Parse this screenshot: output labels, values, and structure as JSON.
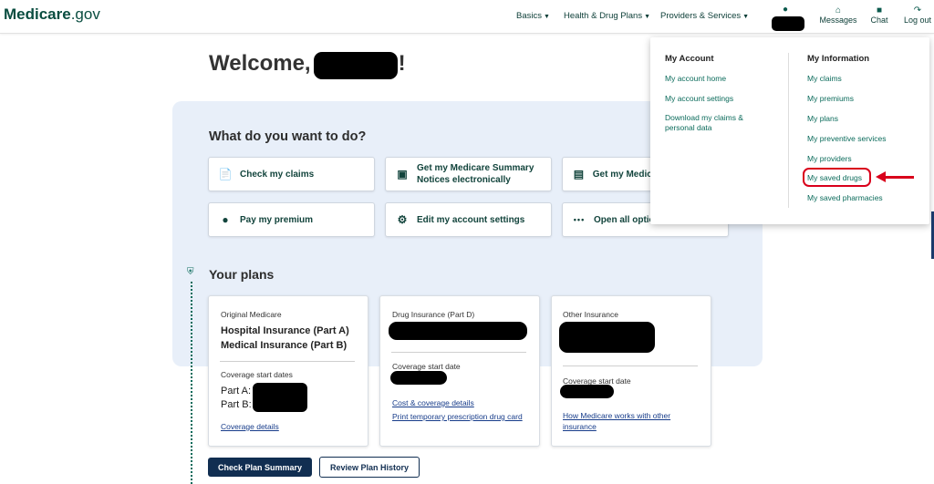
{
  "header": {
    "logo_main": "Medicare",
    "logo_suffix": ".gov",
    "nav": [
      {
        "label": "Basics"
      },
      {
        "label": "Health & Drug Plans"
      },
      {
        "label": "Providers & Services"
      }
    ],
    "icons": [
      {
        "label": "Messages",
        "icon": "home-mail-icon"
      },
      {
        "label": "Chat",
        "icon": "chat-icon"
      },
      {
        "label": "Log out",
        "icon": "logout-icon"
      }
    ]
  },
  "welcome": {
    "prefix": "Welcome,",
    "suffix": "!"
  },
  "actions_panel": {
    "title": "What do you want to do?",
    "buttons": [
      {
        "label": "Check my claims",
        "icon": "document-dollar-icon"
      },
      {
        "label": "Get my Medicare Summary Notices electronically",
        "icon": "laptop-icon"
      },
      {
        "label": "Get my Medica",
        "icon": "id-card-icon"
      },
      {
        "label": "Pay my premium",
        "icon": "dollar-circle-icon"
      },
      {
        "label": "Edit my account settings",
        "icon": "gear-icon"
      },
      {
        "label": "Open all option",
        "icon": "more-dots-icon"
      }
    ]
  },
  "plans": {
    "title": "Your plans",
    "original": {
      "heading": "Original Medicare",
      "line1": "Hospital Insurance (Part A)",
      "line2": "Medical Insurance (Part B)",
      "dates_label": "Coverage start dates",
      "part_a": "Part A:",
      "part_b": "Part B:",
      "link": "Coverage details"
    },
    "drug": {
      "heading": "Drug Insurance (Part D)",
      "date_label": "Coverage start date",
      "link1": "Cost & coverage details",
      "link2": "Print temporary prescription drug card"
    },
    "other": {
      "heading": "Other Insurance",
      "date_label": "Coverage start date",
      "link": "How Medicare works with other insurance"
    },
    "primary_button": "Check Plan Summary",
    "secondary_button": "Review Plan History"
  },
  "dropdown": {
    "account": {
      "heading": "My Account",
      "items": [
        "My account home",
        "My account settings",
        "Download my claims & personal data"
      ]
    },
    "info": {
      "heading": "My Information",
      "items": [
        "My claims",
        "My premiums",
        "My plans",
        "My preventive services",
        "My providers",
        "My saved drugs",
        "My saved pharmacies"
      ]
    }
  },
  "colors": {
    "brand": "#0a4d40",
    "primary_button": "#112e51",
    "panel": "#e8eff9",
    "highlight": "#d9001b"
  }
}
